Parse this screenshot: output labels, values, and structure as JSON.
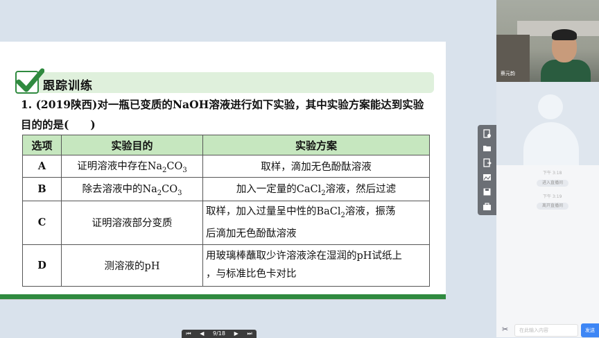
{
  "slide": {
    "section_title": "跟踪训练",
    "question_line1": "1. (2019陕西)对一瓶已变质的NaOH溶液进行如下实验，其中实验方案能达到实验",
    "question_line2": "目的的是(　　)",
    "table": {
      "headers": [
        "选项",
        "实验目的",
        "实验方案"
      ],
      "rows": [
        {
          "option": "A",
          "purpose_pre": "证明溶液中存在Na",
          "purpose_sub1": "2",
          "purpose_mid": "CO",
          "purpose_sub2": "3",
          "plan_line1": "取样，滴加无色酚酞溶液",
          "plan_line2": ""
        },
        {
          "option": "B",
          "purpose_pre": "除去溶液中的Na",
          "purpose_sub1": "2",
          "purpose_mid": "CO",
          "purpose_sub2": "3",
          "plan_pre": "加入一定量的CaCl",
          "plan_sub": "2",
          "plan_post": "溶液，然后过滤"
        },
        {
          "option": "C",
          "purpose": "证明溶液部分变质",
          "plan_line1_pre": "取样，加入过量呈中性的BaCl",
          "plan_line1_sub": "2",
          "plan_line1_post": "溶液，振荡",
          "plan_line2": "后滴加无色酚酞溶液"
        },
        {
          "option": "D",
          "purpose": "测溶液的pH",
          "plan_line1": "用玻璃棒蘸取少许溶液涂在湿润的pH试纸上",
          "plan_line2": "，与标准比色卡对比"
        }
      ]
    }
  },
  "pager": {
    "first": "⏮",
    "prev": "◀",
    "page": "9/18",
    "next": "▶",
    "last": "⏭"
  },
  "video": {
    "name_label": "蔡元韵"
  },
  "chat": {
    "time1": "下午 3:18",
    "pill1": "进入直播间",
    "time2": "下午 3:19",
    "pill2": "离开直播间",
    "input_placeholder": "在此输入内容",
    "send_label": "发送"
  },
  "tools": [
    "add-doc-icon",
    "folder-icon",
    "share-icon",
    "image-icon",
    "save-icon",
    "toolbox-icon"
  ],
  "colors": {
    "accent_green": "#2f8a3f",
    "header_green": "#c6e7bf",
    "send_blue": "#3d86f5"
  }
}
